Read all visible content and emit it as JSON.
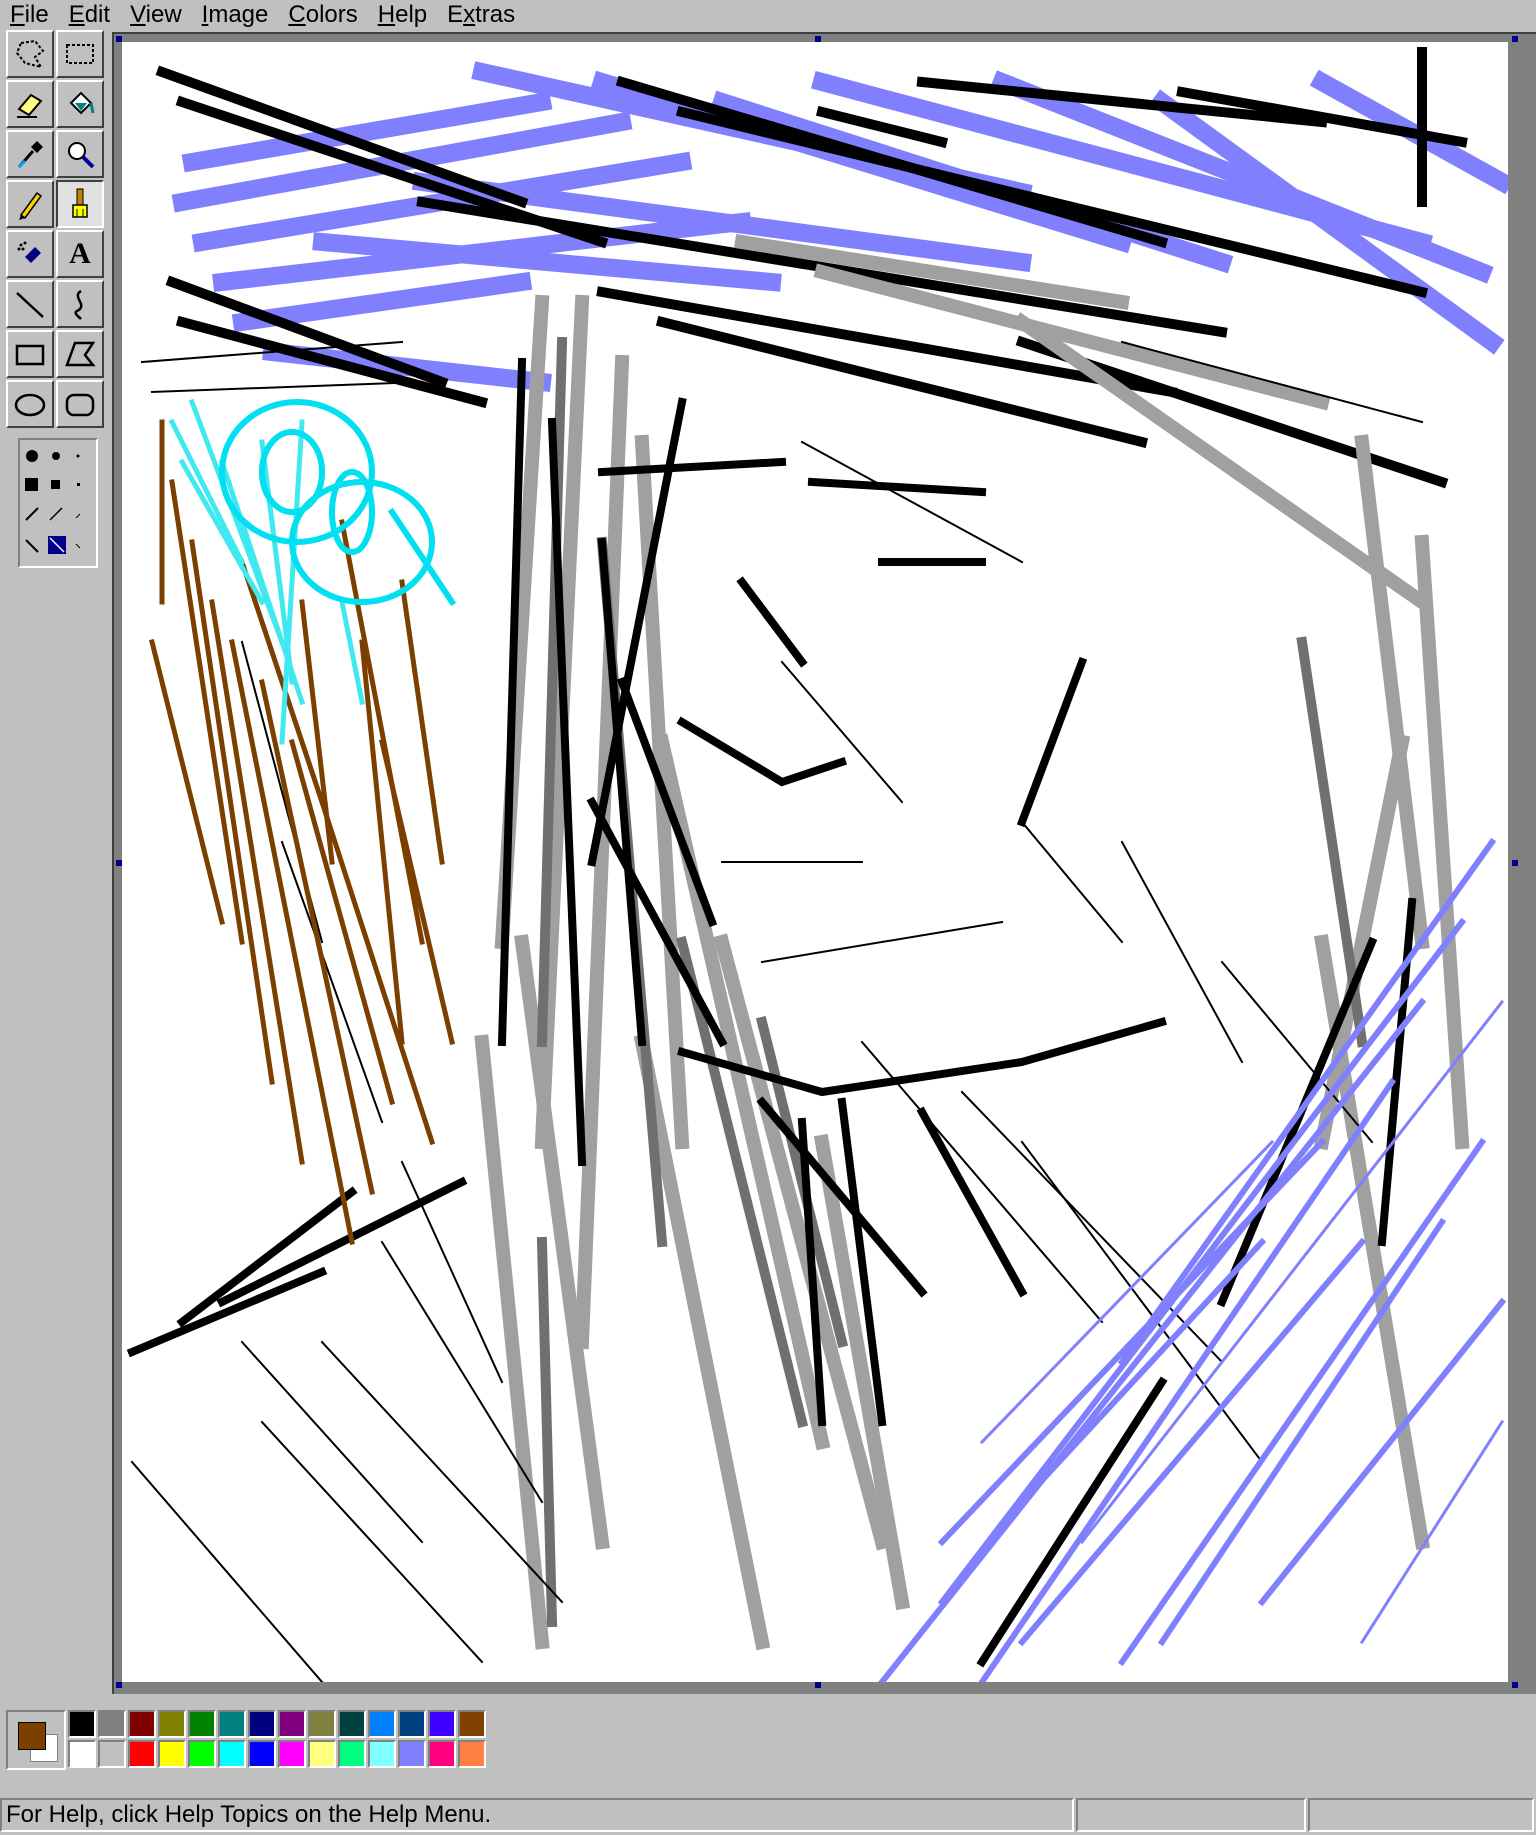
{
  "menu": {
    "items": [
      {
        "pre": "",
        "key": "F",
        "post": "ile"
      },
      {
        "pre": "",
        "key": "E",
        "post": "dit"
      },
      {
        "pre": "",
        "key": "V",
        "post": "iew"
      },
      {
        "pre": "",
        "key": "I",
        "post": "mage"
      },
      {
        "pre": "",
        "key": "C",
        "post": "olors"
      },
      {
        "pre": "",
        "key": "H",
        "post": "elp"
      },
      {
        "pre": "E",
        "key": "x",
        "post": "tras"
      }
    ]
  },
  "tools": [
    {
      "name": "free-form-select-icon"
    },
    {
      "name": "rectangle-select-icon"
    },
    {
      "name": "eraser-icon"
    },
    {
      "name": "fill-bucket-icon"
    },
    {
      "name": "color-picker-icon"
    },
    {
      "name": "magnifier-icon"
    },
    {
      "name": "pencil-icon"
    },
    {
      "name": "brush-icon",
      "pressed": true
    },
    {
      "name": "airbrush-icon"
    },
    {
      "name": "text-icon",
      "label": "A"
    },
    {
      "name": "line-icon"
    },
    {
      "name": "curve-icon"
    },
    {
      "name": "rectangle-icon"
    },
    {
      "name": "polygon-icon"
    },
    {
      "name": "ellipse-icon"
    },
    {
      "name": "rounded-rectangle-icon"
    }
  ],
  "current_colors": {
    "foreground": "#7b3f00",
    "background": "#ffffff"
  },
  "palette": {
    "top": [
      "#000000",
      "#808080",
      "#800000",
      "#808000",
      "#008000",
      "#008080",
      "#000080",
      "#800080",
      "#808040",
      "#004040",
      "#0080ff",
      "#004080",
      "#4000ff",
      "#804000"
    ],
    "bottom": [
      "#ffffff",
      "#c0c0c0",
      "#ff0000",
      "#ffff00",
      "#00ff00",
      "#00ffff",
      "#0000ff",
      "#ff00ff",
      "#ffff80",
      "#00ff80",
      "#80ffff",
      "#8080ff",
      "#ff0080",
      "#ff8040"
    ]
  },
  "statusbar": {
    "help_text": "For Help, click Help Topics on the Help Menu."
  }
}
